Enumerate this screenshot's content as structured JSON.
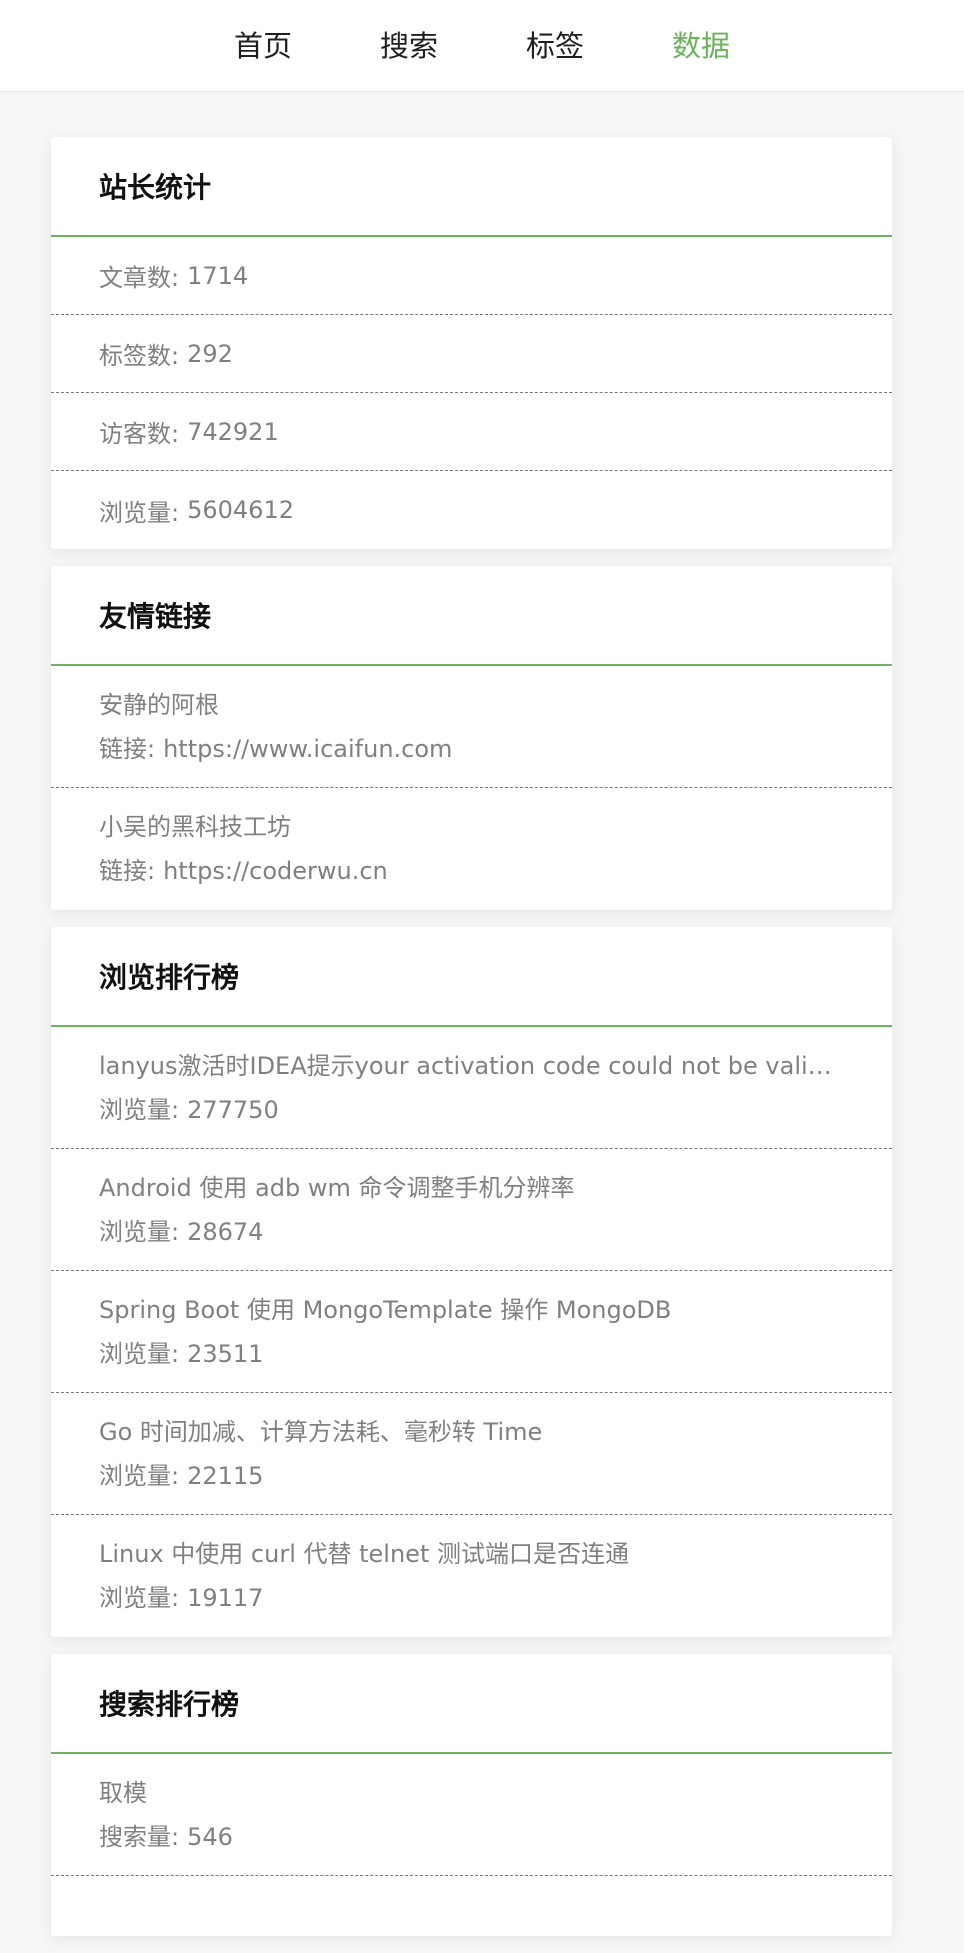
{
  "nav": {
    "items": [
      {
        "label": "首页",
        "active": false
      },
      {
        "label": "搜索",
        "active": false
      },
      {
        "label": "标签",
        "active": false
      },
      {
        "label": "数据",
        "active": true
      }
    ]
  },
  "stats": {
    "title": "站长统计",
    "rows": [
      {
        "label": "文章数:",
        "value": "1714"
      },
      {
        "label": "标签数:",
        "value": "292"
      },
      {
        "label": "访客数:",
        "value": "742921"
      },
      {
        "label": "浏览量:",
        "value": "5604612"
      }
    ]
  },
  "links": {
    "title": "友情链接",
    "rows": [
      {
        "name": "安静的阿根",
        "url_label": "链接:",
        "url": "https://www.icaifun.com"
      },
      {
        "name": "小吴的黑科技工坊",
        "url_label": "链接:",
        "url": "https://coderwu.cn"
      }
    ]
  },
  "views_rank": {
    "title": "浏览排行榜",
    "rows": [
      {
        "title": "lanyus激活时IDEA提示your activation code could not be validate...",
        "count_label": "浏览量:",
        "count": "277750"
      },
      {
        "title": "Android 使用 adb wm 命令调整手机分辨率",
        "count_label": "浏览量:",
        "count": "28674"
      },
      {
        "title": "Spring Boot 使用 MongoTemplate 操作 MongoDB",
        "count_label": "浏览量:",
        "count": "23511"
      },
      {
        "title": "Go 时间加减、计算方法耗、毫秒转 Time",
        "count_label": "浏览量:",
        "count": "22115"
      },
      {
        "title": "Linux 中使用 curl 代替 telnet 测试端口是否连通",
        "count_label": "浏览量:",
        "count": "19117"
      }
    ]
  },
  "search_rank": {
    "title": "搜索排行榜",
    "rows": [
      {
        "keyword": "取模",
        "count_label": "搜索量:",
        "count": "546"
      }
    ]
  },
  "colors": {
    "accent": "#6bb35b",
    "text_muted": "#808080",
    "text_dark": "#1f1f1f",
    "background": "#f6f6f6"
  }
}
